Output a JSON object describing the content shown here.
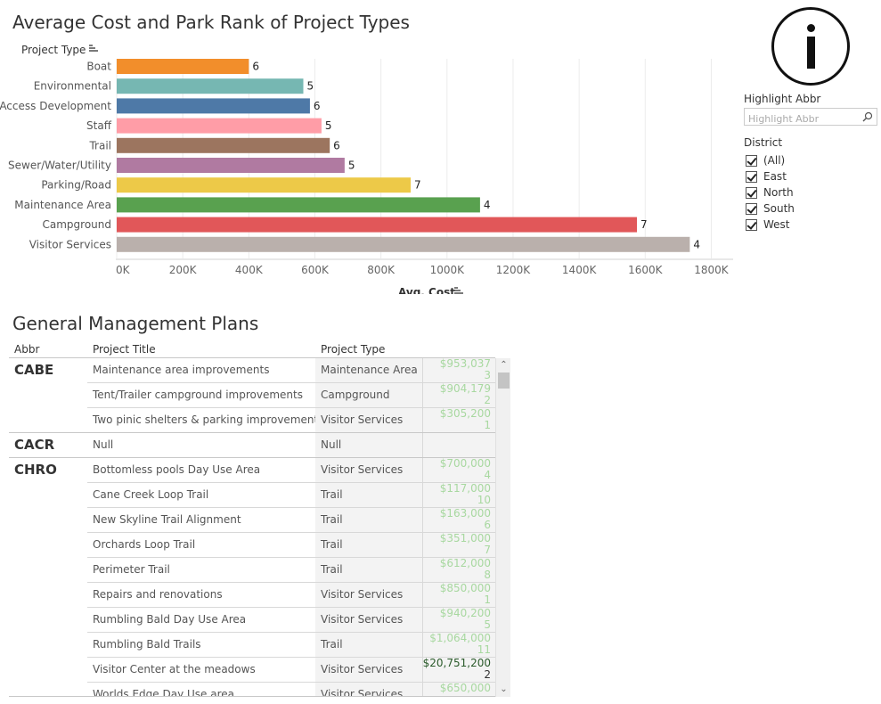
{
  "chart_title": "Average Cost and Park Rank of Project Types",
  "chart_data": {
    "type": "bar",
    "orientation": "horizontal",
    "title": "Average Cost and Park Rank of Project Types",
    "ylabel": "Project Type",
    "xlabel": "Avg. Cost",
    "xlim": [
      0,
      1850000
    ],
    "grid": true,
    "xticks": [
      {
        "value": 0,
        "label": "0K"
      },
      {
        "value": 200000,
        "label": "200K"
      },
      {
        "value": 400000,
        "label": "400K"
      },
      {
        "value": 600000,
        "label": "600K"
      },
      {
        "value": 800000,
        "label": "800K"
      },
      {
        "value": 1000000,
        "label": "1000K"
      },
      {
        "value": 1200000,
        "label": "1200K"
      },
      {
        "value": 1400000,
        "label": "1400K"
      },
      {
        "value": 1600000,
        "label": "1600K"
      },
      {
        "value": 1800000,
        "label": "1800K"
      }
    ],
    "categories": [
      "Boat",
      "Environmental",
      "Access Development",
      "Staff",
      "Trail",
      "Sewer/Water/Utility",
      "Parking/Road",
      "Maintenance Area",
      "Campground",
      "Visitor Services"
    ],
    "values": [
      400000,
      565000,
      585000,
      620000,
      645000,
      690000,
      890000,
      1100000,
      1575000,
      1735000
    ],
    "labels": [
      "6",
      "5",
      "6",
      "5",
      "6",
      "5",
      "7",
      "4",
      "7",
      "4"
    ],
    "colors": [
      "#f28e2b",
      "#76b7b2",
      "#4e79a7",
      "#ff9da7",
      "#9c755f",
      "#b07aa1",
      "#edc948",
      "#59a14f",
      "#e15759",
      "#bab0ac"
    ]
  },
  "info_icon": "info-icon",
  "highlight": {
    "label": "Highlight Abbr",
    "placeholder": "Highlight Abbr",
    "icon": "search-icon"
  },
  "district": {
    "label": "District",
    "options": [
      "(All)",
      "East",
      "North",
      "South",
      "West"
    ]
  },
  "table_title": "General Management Plans",
  "table": {
    "headers": {
      "abbr": "Abbr",
      "title": "Project Title",
      "type": "Project Type"
    },
    "rows": [
      {
        "abbr": "CABE",
        "title": "Maintenance area improvements",
        "type": "Maintenance Area",
        "cost": "$953,037",
        "rank": "3"
      },
      {
        "abbr": "",
        "title": "Tent/Trailer campground improvements",
        "type": "Campground",
        "cost": "$904,179",
        "rank": "2"
      },
      {
        "abbr": "",
        "title": "Two pinic shelters & parking improvements",
        "type": "Visitor Services",
        "cost": "$305,200",
        "rank": "1"
      },
      {
        "abbr": "CACR",
        "title": "Null",
        "type": "Null",
        "cost": "",
        "rank": ""
      },
      {
        "abbr": "CHRO",
        "title": "Bottomless pools Day Use Area",
        "type": "Visitor Services",
        "cost": "$700,000",
        "rank": "4"
      },
      {
        "abbr": "",
        "title": "Cane Creek Loop Trail",
        "type": "Trail",
        "cost": "$117,000",
        "rank": "10"
      },
      {
        "abbr": "",
        "title": "New Skyline Trail Alignment",
        "type": "Trail",
        "cost": "$163,000",
        "rank": "6"
      },
      {
        "abbr": "",
        "title": "Orchards Loop Trail",
        "type": "Trail",
        "cost": "$351,000",
        "rank": "7"
      },
      {
        "abbr": "",
        "title": "Perimeter Trail",
        "type": "Trail",
        "cost": "$612,000",
        "rank": "8"
      },
      {
        "abbr": "",
        "title": "Repairs and renovations",
        "type": "Visitor Services",
        "cost": "$850,000",
        "rank": "1"
      },
      {
        "abbr": "",
        "title": "Rumbling Bald Day Use Area",
        "type": "Visitor Services",
        "cost": "$940,200",
        "rank": "5"
      },
      {
        "abbr": "",
        "title": "Rumbling Bald Trails",
        "type": "Trail",
        "cost": "$1,064,000",
        "rank": "11"
      },
      {
        "abbr": "",
        "title": "Visitor Center at the meadows",
        "type": "Visitor Services",
        "cost": "$20,751,200",
        "rank": "2"
      },
      {
        "abbr": "",
        "title": "Worlds Edge Day Use area",
        "type": "Visitor Services",
        "cost": "$650,000",
        "rank": ""
      }
    ]
  }
}
